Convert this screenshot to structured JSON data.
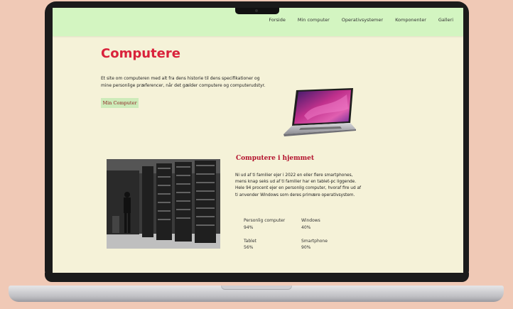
{
  "nav": {
    "items": [
      "Forside",
      "Min computer",
      "Operativsystemer",
      "Komponenter",
      "Galleri"
    ]
  },
  "hero": {
    "title": "Computere",
    "intro": "Et site om computeren med alt fra dens historie til dens specifikationer og mine personlige præferencer, når det gælder computere og computerudstyr.",
    "button_label": "Min Computer"
  },
  "home_section": {
    "heading": "Computere i hjemmet",
    "paragraph": "Ni ud af ti familier ejer i 2022 en eller flere smartphones, mens knap seks ud af ti familier har en tablet-pc liggende. Hele 94 procent ejer en personlig computer, hvoraf fire ud af ti anvender Windows som deres primære operativsystem.",
    "stats": [
      {
        "label": "Personlig computer",
        "value": "94%"
      },
      {
        "label": "Windows",
        "value": "40%"
      },
      {
        "label": "Tablet",
        "value": "56%"
      },
      {
        "label": "Smartphone",
        "value": "90%"
      }
    ]
  },
  "colors": {
    "page_bg": "#f0c9b6",
    "screen_bg": "#f5f2d8",
    "navbar_bg": "#d3f5c1",
    "title_red": "#d9223b",
    "heading_red": "#b3122d",
    "button_bg": "#cdebb9"
  },
  "icons": [
    "laptop-image",
    "server-room-photo"
  ]
}
